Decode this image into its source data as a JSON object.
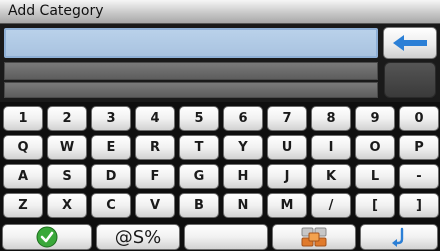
{
  "title": "Add Category",
  "input": {
    "value": "",
    "placeholder": ""
  },
  "keyboard": {
    "row1": [
      "1",
      "2",
      "3",
      "4",
      "5",
      "6",
      "7",
      "8",
      "9",
      "0"
    ],
    "row2": [
      "Q",
      "W",
      "E",
      "R",
      "T",
      "Y",
      "U",
      "I",
      "O",
      "P"
    ],
    "row3": [
      "A",
      "S",
      "D",
      "F",
      "G",
      "H",
      "J",
      "K",
      "L",
      "-"
    ],
    "row4": [
      "Z",
      "X",
      "C",
      "V",
      "B",
      "N",
      "M",
      "/",
      "[",
      "]"
    ],
    "symbols_label": "@S%"
  },
  "icons": {
    "backspace": "arrow-left-icon",
    "confirm": "checkmark-icon",
    "layout": "keyboard-layout-icon",
    "return": "return-arrow-icon"
  },
  "colors": {
    "input_bg": "#b9d1ea",
    "accent_blue": "#2b7fd6",
    "confirm_green": "#3aa83a"
  }
}
